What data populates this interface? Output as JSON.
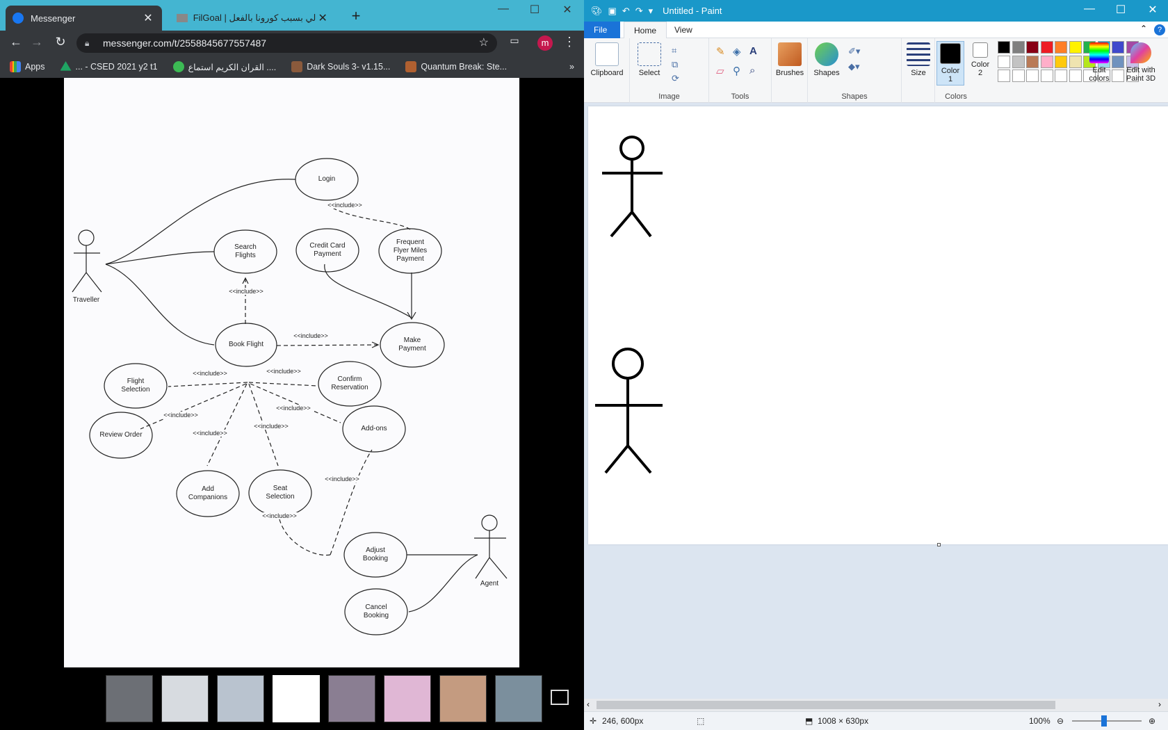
{
  "chrome": {
    "tabs": [
      {
        "title": "Messenger",
        "active": true
      },
      {
        "title": "FilGoal | تالي بسبب كورونا بالفعل",
        "active": false
      }
    ],
    "url": "messenger.com/t/2558845677557487",
    "profile_initial": "m",
    "bookmarks": [
      {
        "label": "Apps",
        "color": "#4285f4"
      },
      {
        "label": "... - CSED 2021 y2 t1",
        "color": "#1fa463"
      },
      {
        "label": "القران الكريم استماع ....",
        "color": "#3cba54"
      },
      {
        "label": "Dark Souls 3- v1.15...",
        "color": "#8a5a3c"
      },
      {
        "label": "Quantum Break: Ste...",
        "color": "#b06030"
      }
    ],
    "overflow_icon": "chevron-double-right-icon"
  },
  "diagram": {
    "actors": [
      "Traveller",
      "Agent"
    ],
    "use_cases": {
      "login": "Login",
      "search": "Search\nFlights",
      "credit": "Credit Card\nPayment",
      "frequent": "Frequent\nFlyer Miles\nPayment",
      "book": "Book Flight",
      "make_payment": "Make\nPayment",
      "flight_selection": "Flight\nSelection",
      "confirm": "Confirm\nReservation",
      "review": "Review Order",
      "addons": "Add-ons",
      "companions": "Add\nCompanions",
      "seat": "Seat\nSelection",
      "adjust": "Adjust\nBooking",
      "cancel": "Cancel\nBooking"
    },
    "include_label": "<<include>>"
  },
  "paint": {
    "title": "Untitled - Paint",
    "tabs": {
      "file": "File",
      "home": "Home",
      "view": "View"
    },
    "groups": {
      "clipboard": "Clipboard",
      "image": "Image",
      "tools": "Tools",
      "shapes": "Shapes",
      "colors": "Colors"
    },
    "buttons": {
      "clipboard": "Clipboard",
      "select": "Select",
      "brushes": "Brushes",
      "shapes": "Shapes",
      "size": "Size",
      "color1": "Color\n1",
      "color2": "Color\n2",
      "edit_colors": "Edit\ncolors",
      "paint3d": "Edit with\nPaint 3D"
    },
    "palette_row1": [
      "#000000",
      "#7f7f7f",
      "#880015",
      "#ed1c24",
      "#ff7f27",
      "#fff200",
      "#22b14c",
      "#00a2e8",
      "#3f48cc",
      "#a349a4"
    ],
    "palette_row2": [
      "#ffffff",
      "#c3c3c3",
      "#b97a57",
      "#ffaec9",
      "#ffc90e",
      "#efe4b0",
      "#b5e61d",
      "#99d9ea",
      "#7092be",
      "#c8bfe7"
    ],
    "status": {
      "cursor": "246, 600px",
      "size": "1008 × 630px",
      "zoom": "100%"
    }
  }
}
